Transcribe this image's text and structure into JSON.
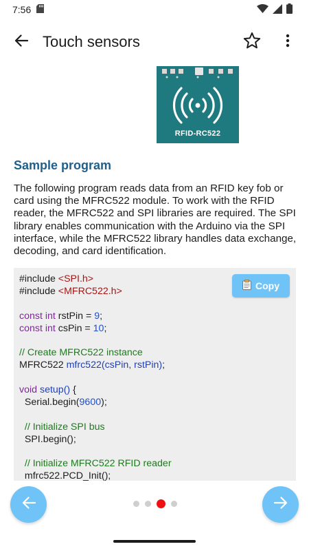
{
  "status_bar": {
    "time": "7:56",
    "icons": [
      "sd-card-icon",
      "wifi-icon",
      "signal-icon",
      "battery-icon"
    ]
  },
  "app_bar": {
    "title": "Touch sensors",
    "back_icon": "arrow-left-icon",
    "favorite_icon": "star-outline-icon",
    "more_icon": "more-vert-icon"
  },
  "module_image": {
    "label": "RFID-RC522"
  },
  "section": {
    "title": "Sample program",
    "description": "The following program reads data from an RFID key fob or card using the MFRC522 module. To work with the RFID reader, the MFRC522 and SPI libraries are required. The SPI library enables communication with the Arduino via the SPI interface, while the MFRC522 library handles data exchange, decoding, and card identification."
  },
  "code": {
    "copy_label": "Copy",
    "lines": [
      [
        {
          "t": "#include "
        },
        {
          "t": "<SPI.h>",
          "c": "kw-red"
        }
      ],
      [
        {
          "t": "#include "
        },
        {
          "t": "<MFRC522.h>",
          "c": "kw-red"
        }
      ],
      [],
      [
        {
          "t": "const int",
          "c": "kw-purple"
        },
        {
          "t": " rstPin = "
        },
        {
          "t": "9",
          "c": "num-blue"
        },
        {
          "t": ";"
        }
      ],
      [
        {
          "t": "const int",
          "c": "kw-purple"
        },
        {
          "t": " csPin = "
        },
        {
          "t": "10",
          "c": "num-blue"
        },
        {
          "t": ";"
        }
      ],
      [],
      [
        {
          "t": "// Create MFRC522 instance",
          "c": "comment"
        }
      ],
      [
        {
          "t": "MFRC522 "
        },
        {
          "t": "mfrc522(csPin, rstPin)",
          "c": "fn-blue"
        },
        {
          "t": ";"
        }
      ],
      [],
      [
        {
          "t": "void",
          "c": "kw-purple"
        },
        {
          "t": " "
        },
        {
          "t": "setup()",
          "c": "fn-blue"
        },
        {
          "t": " {"
        }
      ],
      [
        {
          "t": "  Serial.begin("
        },
        {
          "t": "9600",
          "c": "num-blue"
        },
        {
          "t": ");"
        }
      ],
      [],
      [
        {
          "t": "  // Initialize SPI bus",
          "c": "comment"
        }
      ],
      [
        {
          "t": "  SPI.begin();"
        }
      ],
      [],
      [
        {
          "t": "  // Initialize MFRC522 RFID reader",
          "c": "comment"
        }
      ],
      [
        {
          "t": "  mfrc522.PCD_Init();"
        }
      ]
    ]
  },
  "pagination": {
    "total": 4,
    "current_index": 2
  },
  "colors": {
    "accent": "#6fc3f7",
    "title_blue": "#1f5f8b",
    "active_dot": "#ee1111",
    "module_teal": "#1f7a7f"
  }
}
